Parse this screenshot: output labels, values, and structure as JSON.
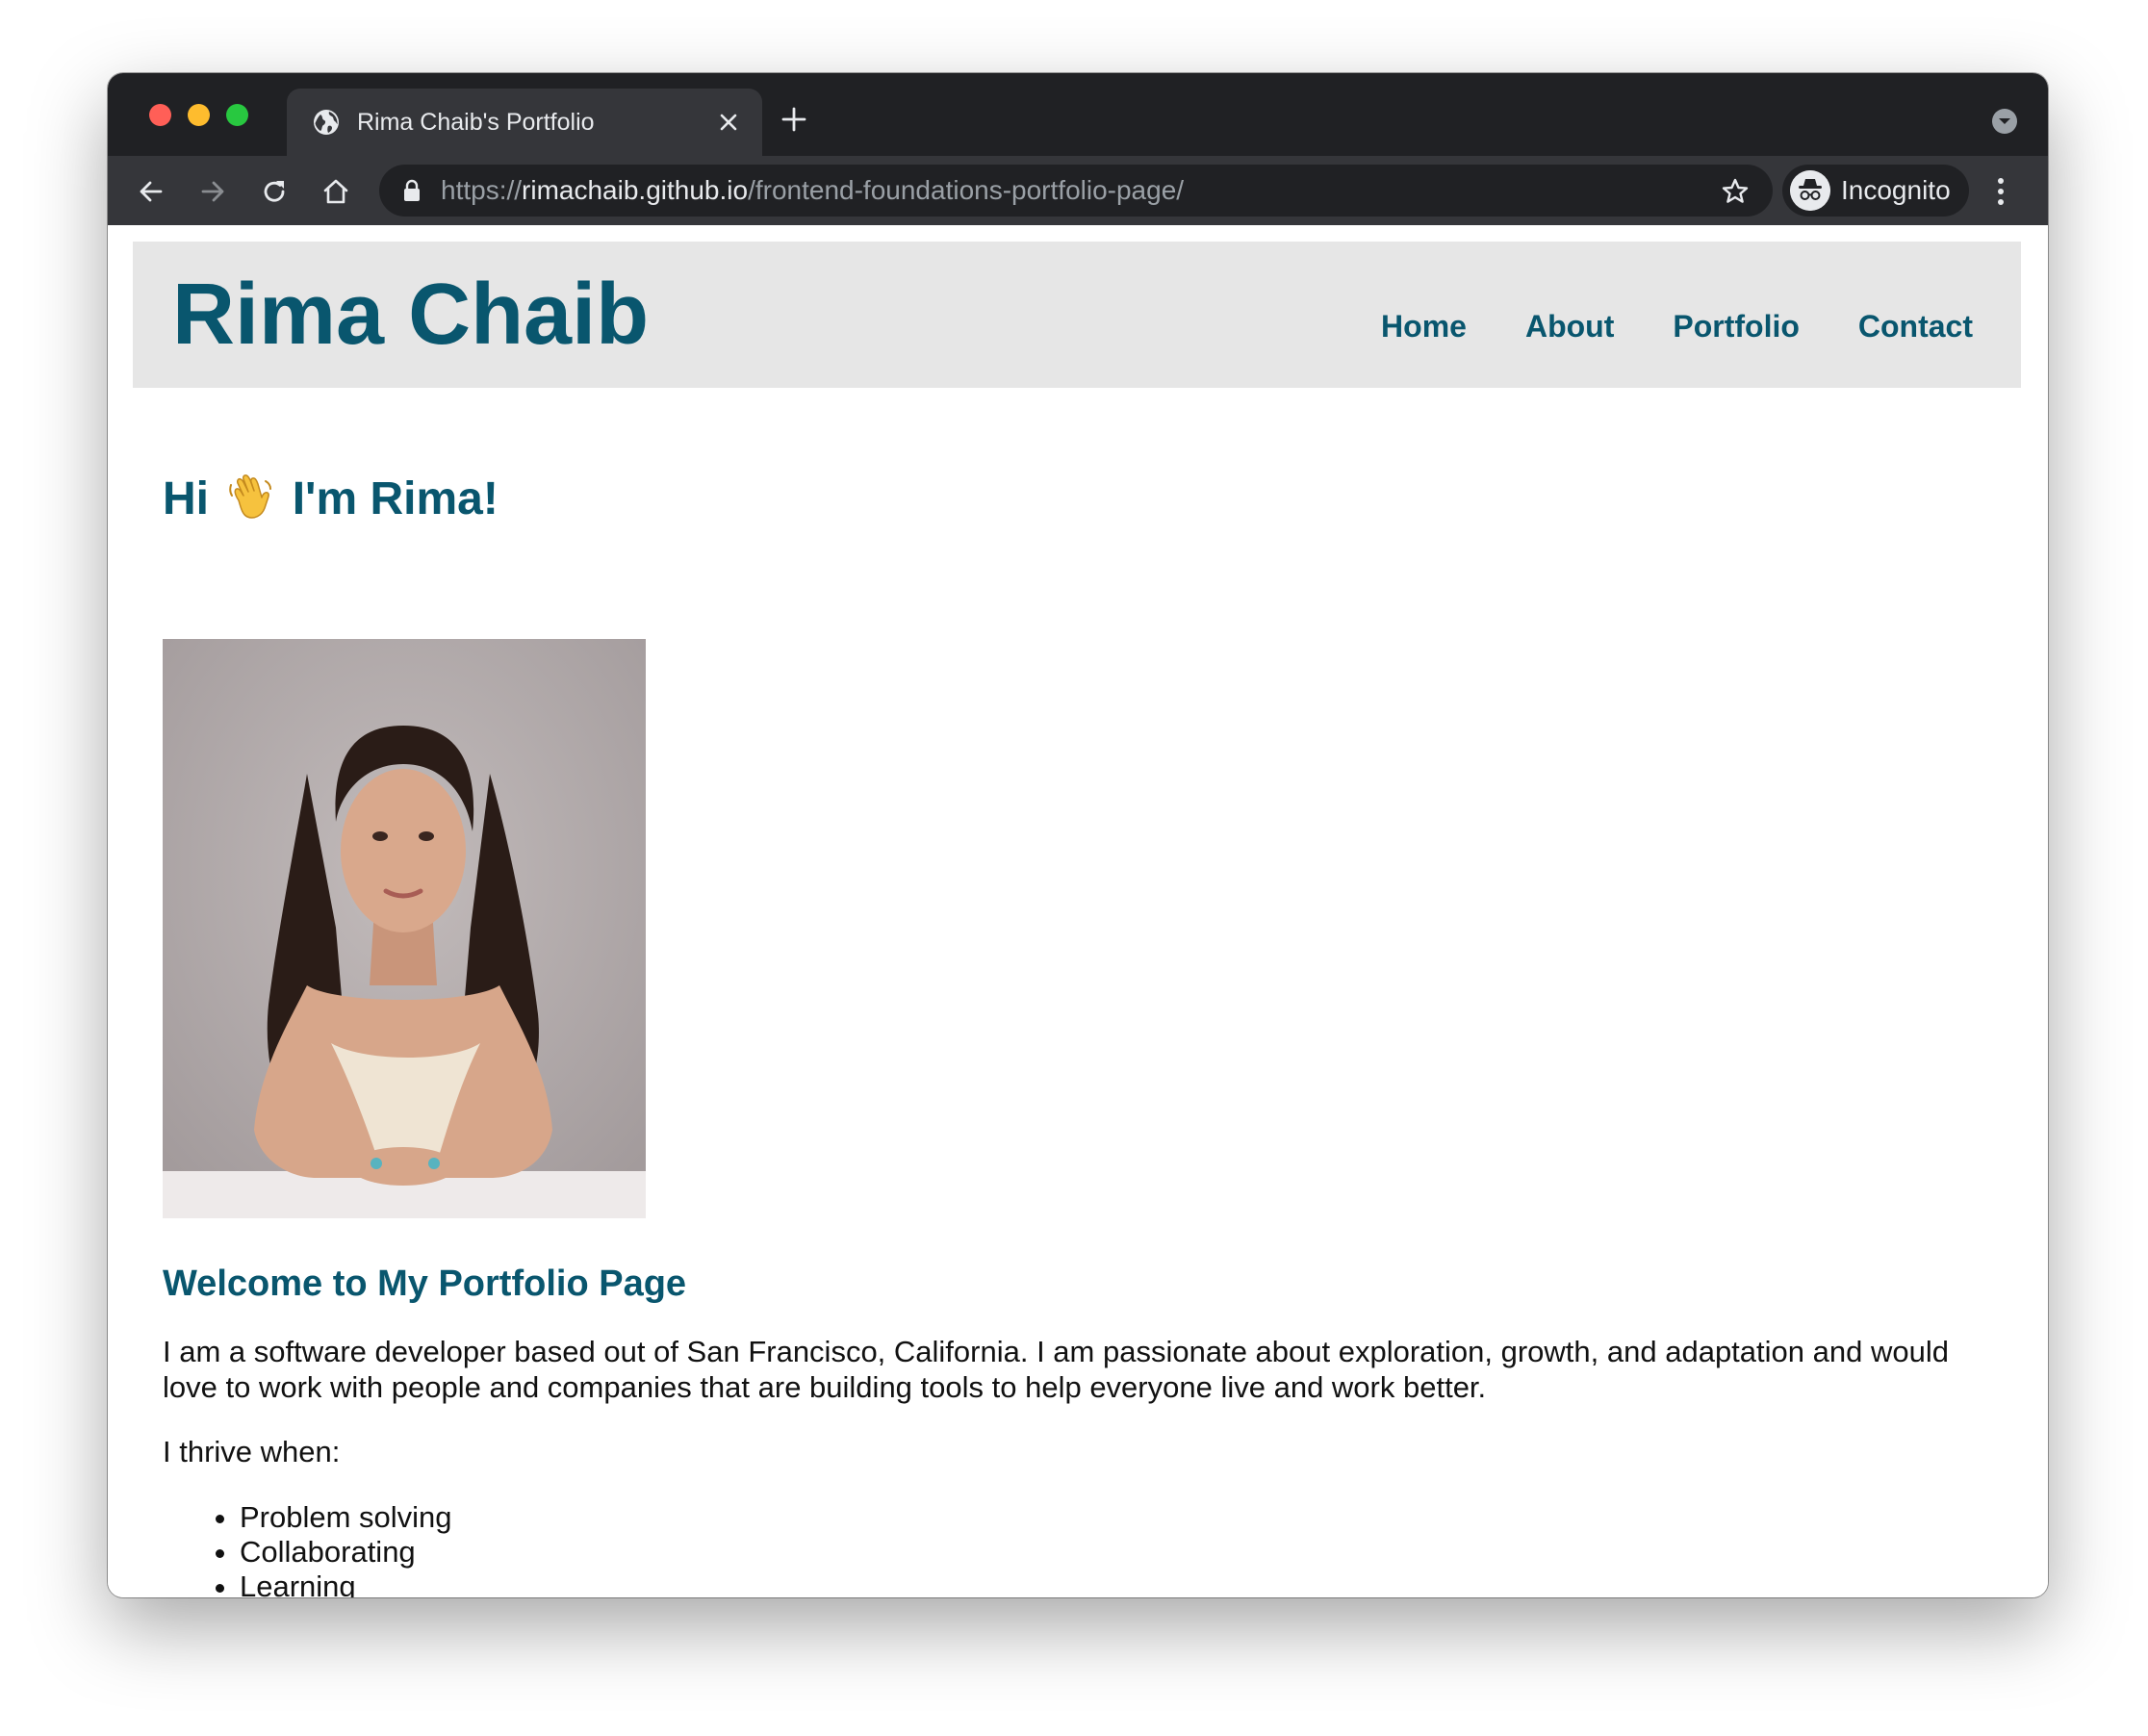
{
  "browser": {
    "tab": {
      "title": "Rima Chaib's Portfolio",
      "favicon": "globe-icon",
      "close": "close-icon"
    },
    "new_tab": "plus-icon",
    "url": {
      "scheme": "https://",
      "host": "rimachaib.github.io",
      "path": "/frontend-foundations-portfolio-page/"
    },
    "profile_label": "Incognito",
    "icons": [
      "back-arrow-icon",
      "forward-arrow-icon",
      "reload-icon",
      "home-icon",
      "lock-icon",
      "star-icon",
      "incognito-icon",
      "kebab-menu-icon",
      "tab-search-icon"
    ]
  },
  "site": {
    "name": "Rima Chaib",
    "nav": [
      {
        "label": "Home"
      },
      {
        "label": "About"
      },
      {
        "label": "Portfolio"
      },
      {
        "label": "Contact"
      }
    ],
    "greeting": {
      "before": "Hi",
      "emoji_icon": "waving-hand-icon",
      "after": "I'm Rima!"
    },
    "section_title": "Welcome to My Portfolio Page",
    "bio": "I am a software developer based out of San Francisco, California. I am passionate about exploration, growth, and adaptation and would love to work with people and companies that are building tools to help everyone live and work better.",
    "thrive_intro": "I thrive when:",
    "strengths": [
      "Problem solving",
      "Collaborating",
      "Learning"
    ]
  },
  "colors": {
    "accent": "#09566e",
    "header_bg": "#e6e6e6",
    "chrome_dark": "#202124",
    "chrome_toolbar": "#35363a"
  }
}
